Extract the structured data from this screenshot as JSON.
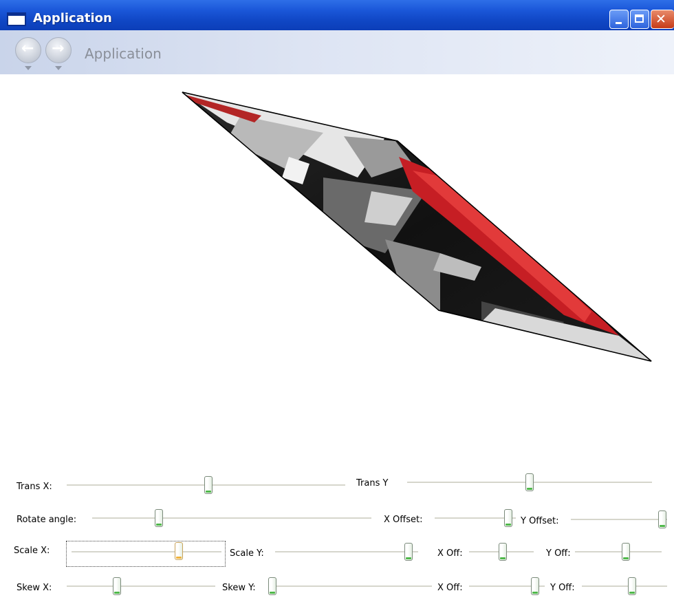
{
  "window": {
    "title": "Application"
  },
  "nav": {
    "title": "Application",
    "back_icon": "arrow-left-icon",
    "forward_icon": "arrow-right-icon"
  },
  "controls": {
    "trans_x": {
      "label": "Trans X:",
      "value_fraction": 0.51
    },
    "trans_y": {
      "label": "Trans Y",
      "value_fraction": 0.5
    },
    "rotate_angle": {
      "label": "Rotate angle:",
      "value_fraction": 0.23
    },
    "x_offset": {
      "label": "X Offset:",
      "value_fraction": 0.95
    },
    "y_offset": {
      "label": "Y Offset:",
      "value_fraction": 0.99
    },
    "scale_x": {
      "label": "Scale X:",
      "value_fraction": 0.73
    },
    "scale_y": {
      "label": "Scale Y:",
      "value_fraction": 0.96
    },
    "scale_x_off": {
      "label": "X Off:",
      "value_fraction": 0.52
    },
    "scale_y_off": {
      "label": "Y Off:",
      "value_fraction": 0.6
    },
    "skew_x": {
      "label": "Skew X:",
      "value_fraction": 0.33
    },
    "skew_y": {
      "label": "Skew Y:",
      "value_fraction": 0.0
    },
    "skew_x_off": {
      "label": "X Off:",
      "value_fraction": 0.92
    },
    "skew_y_off": {
      "label": "Y Off:",
      "value_fraction": 0.6
    }
  },
  "colors": {
    "title_bar": "#1a56d8",
    "accent_red": "#d42626",
    "thumb_green": "#4fb84a",
    "thumb_focus": "#f0b23a"
  }
}
